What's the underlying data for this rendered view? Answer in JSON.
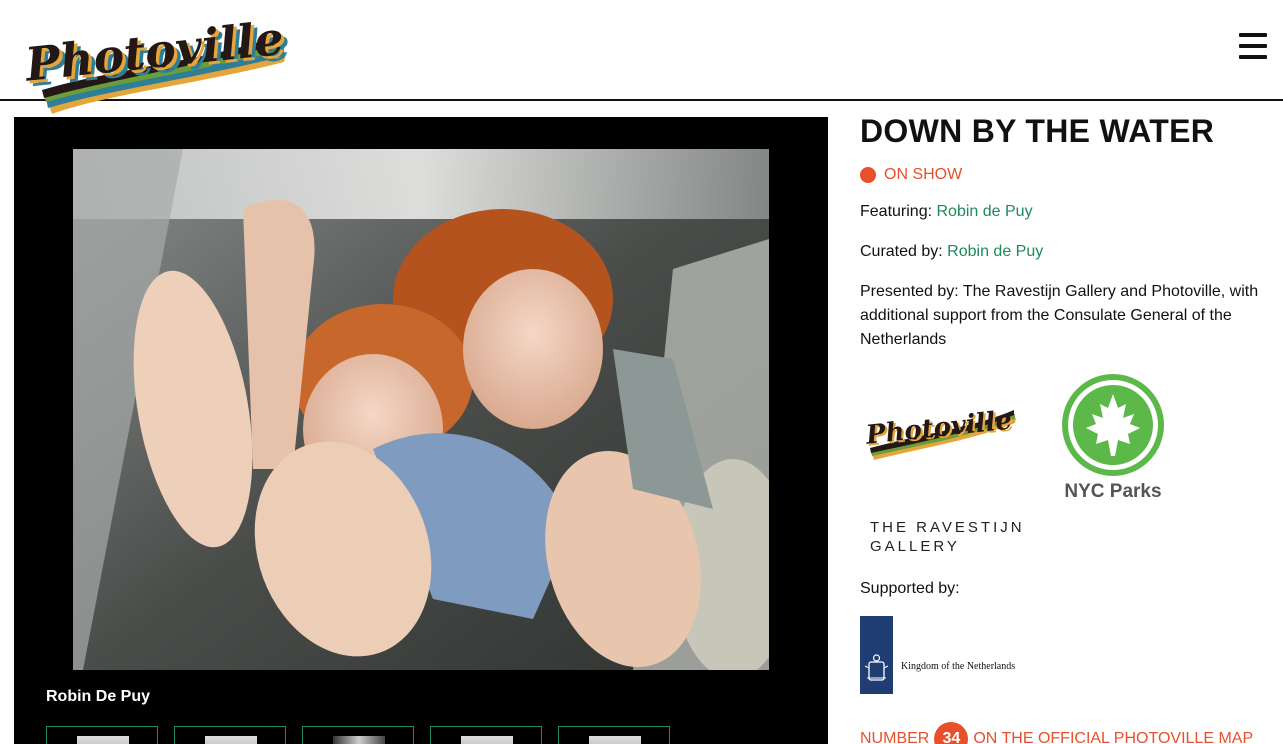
{
  "header": {
    "logo_text": "Photoville",
    "menu_icon": "hamburger-icon"
  },
  "gallery": {
    "caption": "Robin De Puy",
    "thumbnail_count": 5
  },
  "exhibit": {
    "title": "DOWN BY THE WATER",
    "status": "ON SHOW",
    "featuring_label": "Featuring:",
    "featuring_name": "Robin de Puy",
    "curated_label": "Curated by:",
    "curated_name": "Robin de Puy",
    "presented": "Presented by: The Ravestijn Gallery and Photoville, with additional support from the Consulate General of the Netherlands",
    "partner_logos": {
      "photoville": "Photoville",
      "nyc_parks": "NYC Parks",
      "ravestijn_line1": "THE RAVESTIJN",
      "ravestijn_line2": "GALLERY"
    },
    "supported_label": "Supported by:",
    "supporter": "Kingdom of the Netherlands",
    "map_prefix": "NUMBER",
    "map_number": "34",
    "map_suffix": "ON THE OFFICIAL PHOTOVILLE MAP"
  },
  "colors": {
    "accent_orange": "#e8502c",
    "link_green": "#1d8a5b",
    "nyc_green": "#5cb949"
  }
}
